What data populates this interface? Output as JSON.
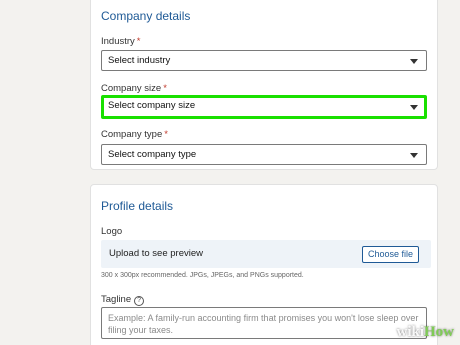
{
  "company_details": {
    "title": "Company details",
    "industry": {
      "label": "Industry",
      "required": "*",
      "value": "Select industry"
    },
    "company_size": {
      "label": "Company size",
      "required": "*",
      "value": "Select company size",
      "highlight_color": "#19e000"
    },
    "company_type": {
      "label": "Company type",
      "required": "*",
      "value": "Select company type"
    }
  },
  "profile_details": {
    "title": "Profile details",
    "logo": {
      "label": "Logo",
      "upload_text": "Upload to see preview",
      "button_label": "Choose file",
      "hint": "300 x 300px recommended. JPGs, JPEGs, and PNGs supported."
    },
    "tagline": {
      "label": "Tagline",
      "help_glyph": "?",
      "placeholder": "Example: A family-run accounting firm that promises you won't lose sleep over filing your taxes."
    }
  },
  "watermark": {
    "part1": "wiki",
    "part2": "How"
  },
  "colors": {
    "accent": "#1f5a96",
    "background": "#f3f2ef"
  }
}
